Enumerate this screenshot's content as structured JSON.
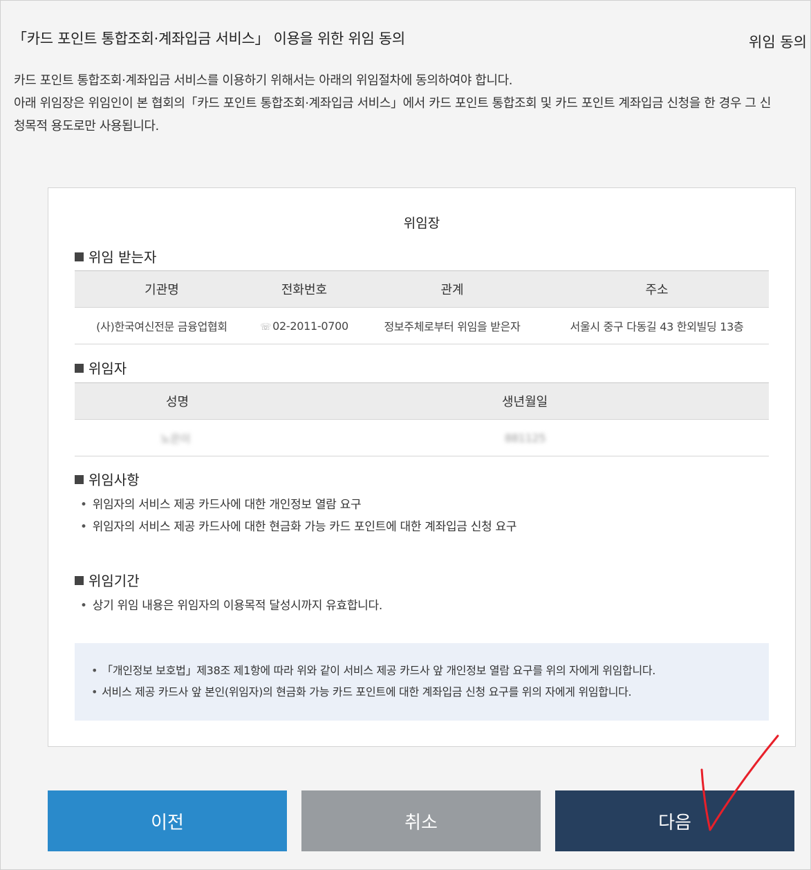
{
  "header": {
    "title": "「카드 포인트 통합조회·계좌입금 서비스」 이용을 위한 위임 동의",
    "step_label": "위임 동의"
  },
  "intro": {
    "line1": "카드 포인트 통합조회·계좌입금 서비스를 이용하기 위해서는 아래의 위임절차에 동의하여야 합니다.",
    "line2": "아래 위임장은 위임인이 본 협회의「카드 포인트 통합조회·계좌입금 서비스」에서 카드 포인트 통합조회 및 카드 포인트 계좌입금 신청을 한 경우 그 신",
    "line3": "청목적 용도로만 사용됩니다."
  },
  "document": {
    "title": "위임장",
    "grantee": {
      "heading": "위임 받는자",
      "columns": [
        "기관명",
        "전화번호",
        "관계",
        "주소"
      ],
      "row": {
        "org": "(사)한국여신전문 금융업협회",
        "phone": "02-2011-0700",
        "relation": "정보주체로부터 위임을 받은자",
        "address": "서울시 중구 다동길 43 한외빌딩 13층"
      }
    },
    "grantor": {
      "heading": "위임자",
      "columns": [
        "성명",
        "생년월일"
      ],
      "row": {
        "name": "노은이",
        "birth": "881125"
      }
    },
    "matters": {
      "heading": "위임사항",
      "items": [
        "위임자의 서비스 제공 카드사에 대한 개인정보 열람 요구",
        "위임자의 서비스 제공 카드사에 대한 현금화 가능 카드 포인트에 대한 계좌입금 신청 요구"
      ]
    },
    "period": {
      "heading": "위임기간",
      "items": [
        "상기 위임 내용은 위임자의 이용목적 달성시까지 유효합니다."
      ]
    },
    "notice": {
      "items": [
        "「개인정보 보호법」제38조 제1항에 따라 위와 같이 서비스 제공 카드사 앞 개인정보 열람 요구를 위의 자에게 위임합니다.",
        "서비스 제공 카드사 앞 본인(위임자)의 현금화 가능 카드 포인트에 대한 계좌입금 신청 요구를 위의 자에게 위임합니다."
      ]
    }
  },
  "buttons": {
    "prev": "이전",
    "cancel": "취소",
    "next": "다음"
  },
  "colors": {
    "prev": "#2a8acb",
    "cancel": "#989ca0",
    "next": "#263f5e",
    "notice_bg": "#ebf0f8",
    "checkmark": "#e8202a"
  }
}
